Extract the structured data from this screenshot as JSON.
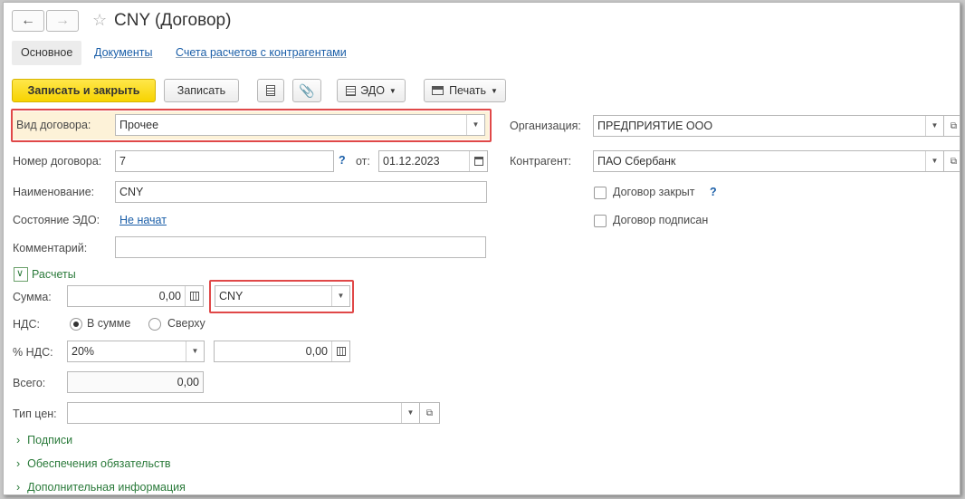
{
  "window": {
    "title": "CNY (Договор)"
  },
  "tabs": [
    {
      "label": "Основное"
    },
    {
      "label": "Документы"
    },
    {
      "label": "Счета расчетов с контрагентами"
    }
  ],
  "toolbar": {
    "save_close": "Записать и закрыть",
    "save": "Записать",
    "edo": "ЭДО",
    "print": "Печать"
  },
  "left": {
    "contract_type_label": "Вид договора:",
    "contract_type_value": "Прочее",
    "number_label": "Номер договора:",
    "number_value": "7",
    "date_from_label": "от:",
    "date_value": "01.12.2023",
    "name_label": "Наименование:",
    "name_value": "CNY",
    "edo_state_label": "Состояние ЭДО:",
    "edo_state_value": "Не начат",
    "comment_label": "Комментарий:",
    "comment_value": ""
  },
  "right": {
    "org_label": "Организация:",
    "org_value": "ПРЕДПРИЯТИЕ ООО",
    "counterparty_label": "Контрагент:",
    "counterparty_value": "ПАО Сбербанк",
    "closed_label": "Договор закрыт",
    "signed_label": "Договор подписан"
  },
  "settlements": {
    "group_label": "Расчеты",
    "sum_label": "Сумма:",
    "sum_value": "0,00",
    "currency_value": "CNY",
    "vat_label": "НДС:",
    "vat_in_sum": "В сумме",
    "vat_on_top": "Сверху",
    "vat_rate_label": "% НДС:",
    "vat_rate_value": "20%",
    "vat_amount_value": "0,00",
    "total_label": "Всего:",
    "total_value": "0,00",
    "price_type_label": "Тип цен:",
    "price_type_value": ""
  },
  "groups": {
    "signatures": "Подписи",
    "obligations": "Обеспечения обязательств",
    "additional": "Дополнительная информация"
  },
  "help_mark": "?"
}
